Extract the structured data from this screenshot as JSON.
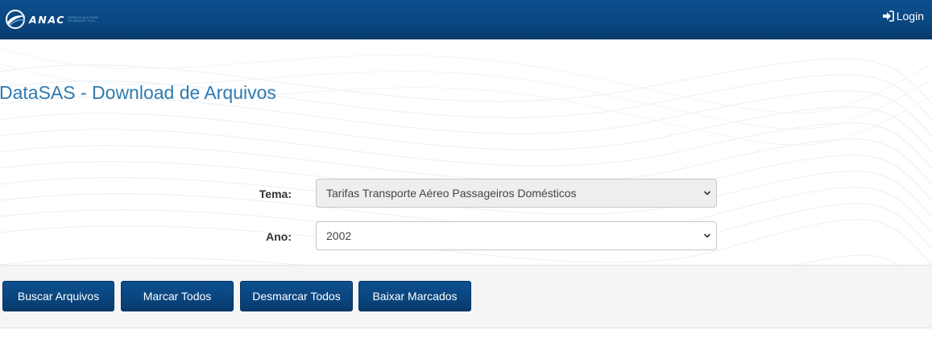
{
  "header": {
    "logo_text": "ANAC",
    "logo_subtext": "AGÊNCIA NACIONAL DE AVIAÇÃO CIVIL",
    "login_label": "Login",
    "bar_color": "#0a467f"
  },
  "page": {
    "title": "DataSAS - Download de Arquivos",
    "title_color": "#2f7ab0"
  },
  "form": {
    "tema": {
      "label": "Tema:",
      "selected": "Tarifas Transporte Aéreo Passageiros Domésticos",
      "disabled": true
    },
    "ano": {
      "label": "Ano:",
      "selected": "2002",
      "disabled": false
    }
  },
  "actions": {
    "buscar": "Buscar Arquivos",
    "marcar": "Marcar Todos",
    "desmarcar": "Desmarcar Todos",
    "baixar": "Baixar Marcados"
  },
  "icons": {
    "login": "sign-in-icon",
    "select_arrow": "chevron-down-icon",
    "logo": "anac-swoosh-logo"
  }
}
